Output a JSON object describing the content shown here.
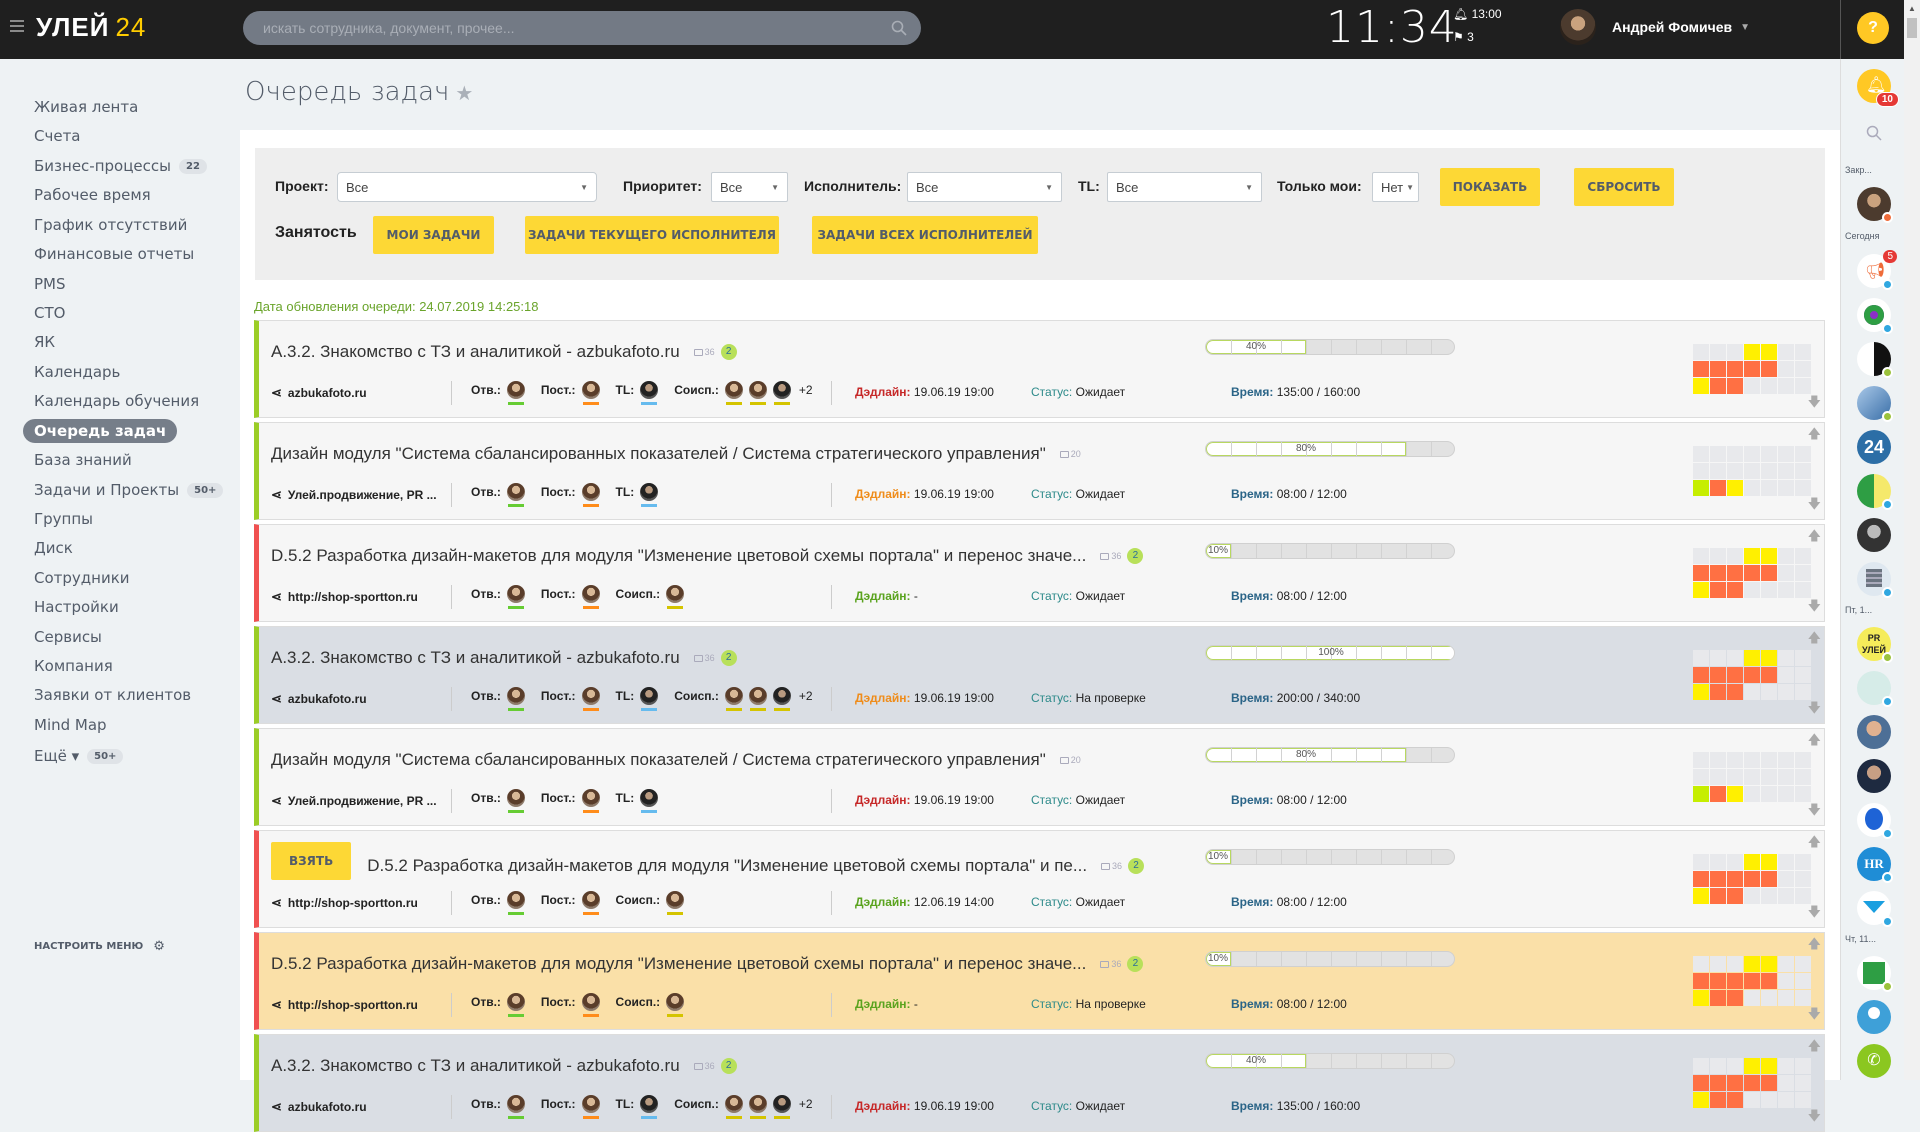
{
  "header": {
    "logo_text": "УЛЕЙ",
    "logo_num": "24",
    "search_placeholder": "искать сотрудника, документ, прочее...",
    "clock": "11:34",
    "alarm_time": "13:00",
    "flag_count": "3",
    "user_name": "Андрей Фомичев",
    "help_label": "?"
  },
  "sidebar": {
    "items": [
      {
        "label": "Живая лента"
      },
      {
        "label": "Счета"
      },
      {
        "label": "Бизнес-процессы",
        "badge": "22"
      },
      {
        "label": "Рабочее время"
      },
      {
        "label": "График отсутствий"
      },
      {
        "label": "Финансовые отчеты"
      },
      {
        "label": "PMS"
      },
      {
        "label": "СТО"
      },
      {
        "label": "ЯК"
      },
      {
        "label": "Календарь"
      },
      {
        "label": "Календарь обучения"
      },
      {
        "label": "Очередь задач",
        "active": true
      },
      {
        "label": "База знаний"
      },
      {
        "label": "Задачи и Проекты",
        "badge": "50+"
      },
      {
        "label": "Группы"
      },
      {
        "label": "Диск"
      },
      {
        "label": "Сотрудники"
      },
      {
        "label": "Настройки"
      },
      {
        "label": "Сервисы"
      },
      {
        "label": "Компания"
      },
      {
        "label": "Заявки от клиентов"
      },
      {
        "label": "Mind Map"
      },
      {
        "label": "Ещё ▾",
        "badge": "50+"
      }
    ],
    "settings_label": "НАСТРОИТЬ МЕНЮ"
  },
  "page": {
    "title": "Очередь задач",
    "updated": "Дата обновления очереди: 24.07.2019 14:25:18"
  },
  "filters": {
    "project_label": "Проект:",
    "project_value": "Все",
    "priority_label": "Приоритет:",
    "priority_value": "Все",
    "executor_label": "Исполнитель:",
    "executor_value": "Все",
    "tl_label": "TL:",
    "tl_value": "Все",
    "only_mine_label": "Только мои:",
    "only_mine_value": "Нет",
    "show_button": "ПОКАЗАТЬ",
    "reset_button": "СБРОСИТЬ",
    "load_label": "Занятость",
    "my_tasks": "МОИ ЗАДАЧИ",
    "current_exec_tasks": "ЗАДАЧИ ТЕКУЩЕГО ИСПОЛНИТЕЛЯ",
    "all_exec_tasks": "ЗАДАЧИ ВСЕХ ИСПОЛНИТЕЛЕЙ"
  },
  "labels": {
    "resp": "Отв.:",
    "setter": "Пост.:",
    "tl": "TL:",
    "coexec": "Соисп.:",
    "deadline": "Дэдлайн:",
    "status": "Статус:",
    "time": "Время:",
    "take": "ВЗЯТЬ"
  },
  "tasks": [
    {
      "title": "А.3.2. Знакомство с ТЗ и аналитикой - azbukafoto.ru",
      "comments": "36",
      "new": "2",
      "project": "azbukafoto.ru",
      "has_tl": true,
      "coexec": 3,
      "extra": "+2",
      "deadline": "19.06.19 19:00",
      "deadline_color": "red",
      "status": "Ожидает",
      "time": "135:00 / 160:00",
      "progress": 40,
      "border": "green",
      "bg": "default"
    },
    {
      "title": "Дизайн модуля \"Система сбалансированных показателей / Система стратегического управления\"",
      "comments": "20",
      "new": "",
      "project": "Улей.продвижение, PR ...",
      "has_tl": true,
      "coexec": 0,
      "extra": "",
      "deadline": "19.06.19 19:00",
      "deadline_color": "orange",
      "status": "Ожидает",
      "time": "08:00 / 12:00",
      "progress": 80,
      "border": "green",
      "bg": "default"
    },
    {
      "title": "D.5.2 Разработка дизайн-макетов для модуля \"Изменение цветовой схемы портала\" и перенос значе...",
      "comments": "36",
      "new": "2",
      "project": "http://shop-sportton.ru",
      "has_tl": false,
      "coexec": 1,
      "extra": "",
      "deadline": "-",
      "deadline_color": "green",
      "status": "Ожидает",
      "time": "08:00 / 12:00",
      "progress": 10,
      "border": "red",
      "bg": "default"
    },
    {
      "title": "А.3.2. Знакомство с ТЗ и аналитикой - azbukafoto.ru",
      "comments": "36",
      "new": "2",
      "project": "azbukafoto.ru",
      "has_tl": true,
      "coexec": 3,
      "extra": "+2",
      "deadline": "19.06.19 19:00",
      "deadline_color": "orange",
      "status": "На проверке",
      "time": "200:00 / 340:00",
      "progress": 100,
      "border": "green",
      "bg": "gray"
    },
    {
      "title": "Дизайн модуля \"Система сбалансированных показателей / Система стратегического управления\"",
      "comments": "20",
      "new": "",
      "project": "Улей.продвижение, PR ...",
      "has_tl": true,
      "coexec": 0,
      "extra": "",
      "deadline": "19.06.19 19:00",
      "deadline_color": "red",
      "status": "Ожидает",
      "time": "08:00 / 12:00",
      "progress": 80,
      "border": "green",
      "bg": "default"
    },
    {
      "title": "D.5.2 Разработка дизайн-макетов для модуля \"Изменение цветовой схемы портала\" и пе...",
      "comments": "36",
      "new": "2",
      "project": "http://shop-sportton.ru",
      "has_tl": false,
      "coexec": 1,
      "extra": "",
      "deadline": "12.06.19 14:00",
      "deadline_color": "green",
      "status": "Ожидает",
      "time": "08:00 / 12:00",
      "progress": 10,
      "border": "red",
      "bg": "default",
      "take": true
    },
    {
      "title": "D.5.2 Разработка дизайн-макетов для модуля \"Изменение цветовой схемы портала\" и перенос значе...",
      "comments": "36",
      "new": "2",
      "project": "http://shop-sportton.ru",
      "has_tl": false,
      "coexec": 1,
      "extra": "",
      "deadline": "-",
      "deadline_color": "green",
      "status": "На проверке",
      "time": "08:00 / 12:00",
      "progress": 10,
      "border": "red",
      "bg": "orange"
    },
    {
      "title": "А.3.2. Знакомство с ТЗ и аналитикой - azbukafoto.ru",
      "comments": "36",
      "new": "2",
      "project": "azbukafoto.ru",
      "has_tl": true,
      "coexec": 3,
      "extra": "+2",
      "deadline": "19.06.19 19:00",
      "deadline_color": "red",
      "status": "Ожидает",
      "time": "135:00 / 160:00",
      "progress": 40,
      "border": "green",
      "bg": "gray"
    }
  ],
  "load_grids": {
    "a": [
      "",
      "",
      "",
      "y",
      "y",
      "",
      "",
      "o",
      "o",
      "o",
      "o",
      "o",
      "",
      "",
      "y",
      "o",
      "o",
      "",
      "",
      "",
      ""
    ],
    "b": [
      "",
      "",
      "",
      "",
      "",
      "",
      "",
      "",
      "",
      "",
      "",
      "",
      "",
      "",
      "g",
      "o",
      "y",
      "",
      "",
      "",
      ""
    ]
  },
  "right_panel": {
    "notifications_count": "10",
    "labels": [
      "Закр...",
      "Сегодня",
      "Пт, 1...",
      "Чт, 11..."
    ],
    "chat_badge": "5",
    "b24_label": "24",
    "hr_label": "HR"
  }
}
